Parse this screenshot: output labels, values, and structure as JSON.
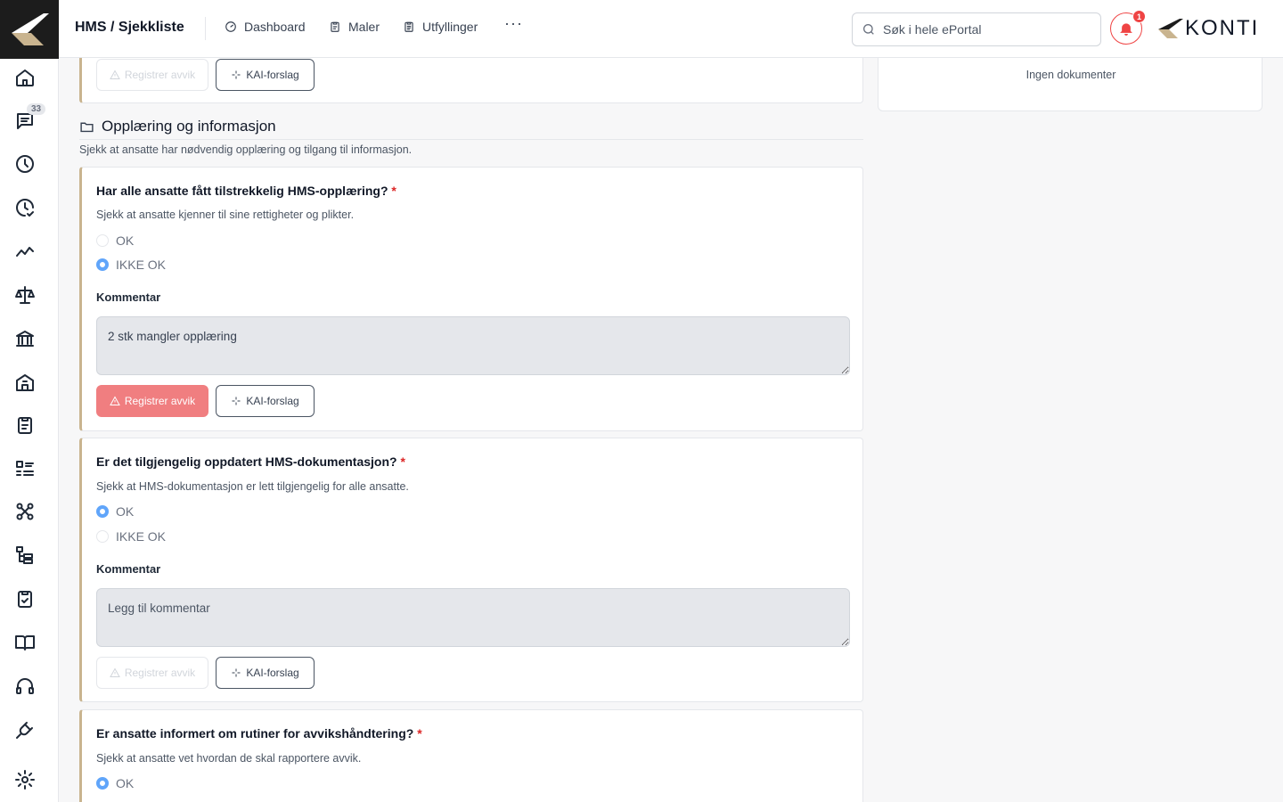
{
  "header": {
    "breadcrumb": "HMS / Sjekkliste",
    "nav": [
      {
        "label": "Dashboard",
        "icon": "gauge-icon"
      },
      {
        "label": "Maler",
        "icon": "clipboard-icon"
      },
      {
        "label": "Utfyllinger",
        "icon": "clipboard-list-icon"
      }
    ],
    "more": "···",
    "search_placeholder": "Søk i hele ePortal",
    "notification_count": "1",
    "brand": "KONTI"
  },
  "sidebar": {
    "chat_badge": "33",
    "items": [
      "home",
      "chat",
      "clock",
      "clock-check",
      "trend",
      "scale",
      "bank",
      "building",
      "clipboard",
      "list",
      "network",
      "tree",
      "clipboard-check",
      "book",
      "headset",
      "plug",
      "settings"
    ]
  },
  "top_card": {
    "register_label": "Registrer avvik",
    "kai_label": "KAI-forslag"
  },
  "section": {
    "title": "Opplæring og informasjon",
    "description": "Sjekk at ansatte har nødvendig opplæring og tilgang til informasjon."
  },
  "questions": [
    {
      "title": "Har alle ansatte fått tilstrekkelig HMS-opplæring?",
      "required": "*",
      "subtitle": "Sjekk at ansatte kjenner til sine rettigheter og plikter.",
      "option_ok": "OK",
      "option_not_ok": "IKKE OK",
      "selected": "IKKE OK",
      "comment_label": "Kommentar",
      "comment_value": "2 stk mangler opplæring",
      "comment_placeholder": "Legg til kommentar",
      "register_label": "Registrer avvik",
      "kai_label": "KAI-forslag"
    },
    {
      "title": "Er det tilgjengelig oppdatert HMS-dokumentasjon?",
      "required": "*",
      "subtitle": "Sjekk at HMS-dokumentasjon er lett tilgjengelig for alle ansatte.",
      "option_ok": "OK",
      "option_not_ok": "IKKE OK",
      "selected": "OK",
      "comment_label": "Kommentar",
      "comment_value": "",
      "comment_placeholder": "Legg til kommentar",
      "register_label": "Registrer avvik",
      "kai_label": "KAI-forslag"
    },
    {
      "title": "Er ansatte informert om rutiner for avvikshåndtering?",
      "required": "*",
      "subtitle": "Sjekk at ansatte vet hvordan de skal rapportere avvik.",
      "option_ok": "OK",
      "selected": "OK"
    }
  ],
  "documents": {
    "empty_text": "Ingen dokumenter"
  },
  "colors": {
    "accent_border": "#c9b48f",
    "danger": "#ef4444",
    "register_active": "#f07e80",
    "radio_selected": "#60a5fa"
  }
}
